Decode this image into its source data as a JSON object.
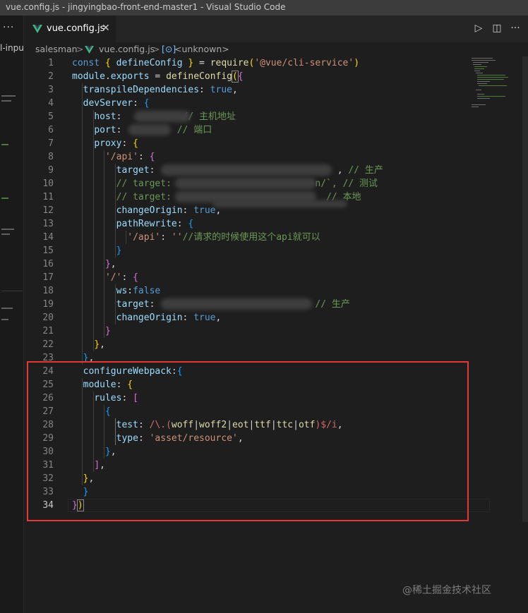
{
  "window": {
    "title": "vue.config.js - jingyingbao-front-end-master1 - Visual Studio Code"
  },
  "sidebar": {
    "more_glyph": "···",
    "fragment_text": "l-inpu"
  },
  "tab": {
    "label": "vue.config.js",
    "close_glyph": "✕",
    "icon": "vue-icon"
  },
  "editor_actions": {
    "run_glyph": "▷",
    "split_glyph": "◫",
    "more_glyph": "···"
  },
  "breadcrumb": {
    "folder": "salesman",
    "file": "vue.config.js",
    "symbol_icon": "symbol-icon",
    "symbol_glyph": "[⊙]",
    "symbol": "<unknown>",
    "separator": ">"
  },
  "code": {
    "current_line": 34,
    "line_numbers": [
      "1",
      "2",
      "3",
      "4",
      "5",
      "6",
      "7",
      "8",
      "9",
      "10",
      "11",
      "12",
      "13",
      "14",
      "15",
      "16",
      "17",
      "18",
      "19",
      "20",
      "21",
      "22",
      "23",
      "24",
      "25",
      "26",
      "27",
      "28",
      "29",
      "30",
      "31",
      "32",
      "33",
      "34"
    ],
    "l1": {
      "const": "const",
      "open": "{ ",
      "name": "defineConfig",
      "close": " }",
      "eq": " = ",
      "req": "require",
      "lp": "(",
      "str": "'@vue/cli-service'",
      "rp": ")"
    },
    "l2": {
      "module": "module",
      "dot": ".",
      "exports": "exports",
      "eq": " = ",
      "fn": "defineConfig",
      "lp": "(",
      "lb": "{"
    },
    "l3": {
      "key": "transpileDependencies",
      "colon": ": ",
      "val": "true",
      "comma": ","
    },
    "l4": {
      "key": "devServer",
      "colon": ": ",
      "lb": "{"
    },
    "l5": {
      "key": "host",
      "colon": ": ",
      "comment": "// 主机地址"
    },
    "l6": {
      "key": "port",
      "colon": ": ",
      "comment": "// 端口"
    },
    "l7": {
      "key": "proxy",
      "colon": ": ",
      "lb": "{"
    },
    "l8": {
      "key": "'/api'",
      "colon": ": ",
      "lb": "{"
    },
    "l9": {
      "key": "target",
      "colon": ": ",
      "tail": ", ",
      "comment": "// 生产"
    },
    "l10": {
      "comment_a": "// target:",
      "comment_b": "n/`, // 测试"
    },
    "l11": {
      "comment_a": "// target:",
      "comment_b": "// 本地"
    },
    "l12": {
      "key": "changeOrigin",
      "colon": ": ",
      "val": "true",
      "comma": ","
    },
    "l13": {
      "key": "pathRewrite",
      "colon": ": ",
      "lb": "{"
    },
    "l14": {
      "key": "'/api'",
      "colon": ": ",
      "val": "''",
      "comment": "//请求的时候使用这个api就可以"
    },
    "l15": {
      "rb": "}"
    },
    "l16": {
      "rb": "}",
      "comma": ","
    },
    "l17": {
      "key": "'/'",
      "colon": ": ",
      "lb": "{"
    },
    "l18": {
      "key": "ws",
      "colon": ":",
      "val": "false"
    },
    "l19": {
      "key": "target",
      "colon": ": ",
      "comment": "// 生产"
    },
    "l20": {
      "key": "changeOrigin",
      "colon": ": ",
      "val": "true",
      "comma": ","
    },
    "l21": {
      "rb": "}"
    },
    "l22": {
      "rb": "}",
      "comma": ","
    },
    "l23": {
      "rb": "}",
      "comma": ","
    },
    "l24": {
      "key": "configureWebpack",
      "colon": ":",
      "lb": "{"
    },
    "l25": {
      "key": "module",
      "colon": ": ",
      "lb": "{"
    },
    "l26": {
      "key": "rules",
      "colon": ": ",
      "lb": "["
    },
    "l27": {
      "lb": "{"
    },
    "l28": {
      "key": "test",
      "colon": ": ",
      "rx_start": "/\\.",
      "rx_open": "(",
      "rx_alts": [
        "woff",
        "woff2",
        "eot",
        "ttf",
        "ttc",
        "otf"
      ],
      "rx_pipe": "|",
      "rx_close": ")",
      "rx_end": "$/i",
      "comma": ","
    },
    "l29": {
      "key": "type",
      "colon": ": ",
      "val": "'asset/resource'",
      "comma": ","
    },
    "l30": {
      "rb": "}",
      "comma": ","
    },
    "l31": {
      "rb": "]",
      "comma": ","
    },
    "l32": {
      "rb": "}",
      "comma": ","
    },
    "l33": {
      "rb": "}"
    },
    "l34": {
      "rb": "}",
      "rp": ")"
    }
  },
  "watermark": "@稀土掘金技术社区"
}
